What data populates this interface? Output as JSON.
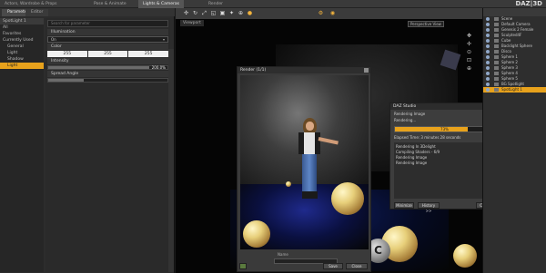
{
  "topbar": {
    "tabs": [
      {
        "label": "Actors, Wardrobe & Props",
        "active": false
      },
      {
        "label": "Pose & Animate",
        "active": false
      },
      {
        "label": "Lights & Cameras",
        "active": true
      },
      {
        "label": "Render",
        "active": false
      }
    ],
    "logo": "DAZ|3D"
  },
  "left_panel": {
    "tabs": [
      "Parameters",
      "Editor"
    ],
    "filter_items": [
      "SpotLight 1",
      "All",
      "Favorites",
      "Currently Used",
      "General",
      "Light",
      "Shadow",
      "Light"
    ],
    "filter_selected_index": 7,
    "search_placeholder": "Search by filter",
    "property_search_placeholder": "Search for parameter",
    "illumination_label": "Illumination",
    "illumination_value": "On",
    "color_label": "Color",
    "color_values": [
      "255",
      "255",
      "255"
    ],
    "intensity_label": "Intensity",
    "intensity_value": "200.0%",
    "intensity_fraction": 0.85,
    "spread_label": "Spread Angle",
    "spread_fraction": 0.3
  },
  "viewport": {
    "label": "Viewport",
    "perspective_label": "Perspective View",
    "camera_letter": "C"
  },
  "render_window": {
    "title": "Render (1/1)",
    "name_label": "Name",
    "save_label": "Save",
    "close_label": "Close"
  },
  "progress_dialog": {
    "title": "DAZ Studio",
    "status_top": "Rendering Image",
    "status_line": "Rendering...",
    "progress_percent": "73%",
    "progress_fraction": 0.73,
    "elapsed": "Elapsed Time: 3 minutes 28 seconds",
    "log_lines": [
      "Rendering In 3Delight",
      "Compiling Shaders - 6/9",
      "Rendering Image",
      "Rendering Image"
    ],
    "minimize_label": "Minimize",
    "history_label": "History >>",
    "cancel_label": "Cancel"
  },
  "scene_panel": {
    "items": [
      {
        "label": "Scene",
        "selected": false
      },
      {
        "label": "Default Camera",
        "selected": false
      },
      {
        "label": "Genesis 2 Female",
        "selected": false
      },
      {
        "label": "Sculpted4F",
        "selected": false
      },
      {
        "label": "Cube",
        "selected": false
      },
      {
        "label": "Backlight Sphere",
        "selected": false
      },
      {
        "label": "Disco",
        "selected": false
      },
      {
        "label": "Sphere 1",
        "selected": false
      },
      {
        "label": "Sphere 2",
        "selected": false
      },
      {
        "label": "Sphere 3",
        "selected": false
      },
      {
        "label": "Sphere 4",
        "selected": false
      },
      {
        "label": "Sphere 5",
        "selected": false
      },
      {
        "label": "BG Spotlight",
        "selected": false
      },
      {
        "label": "SpotLight 1",
        "selected": true
      }
    ]
  }
}
